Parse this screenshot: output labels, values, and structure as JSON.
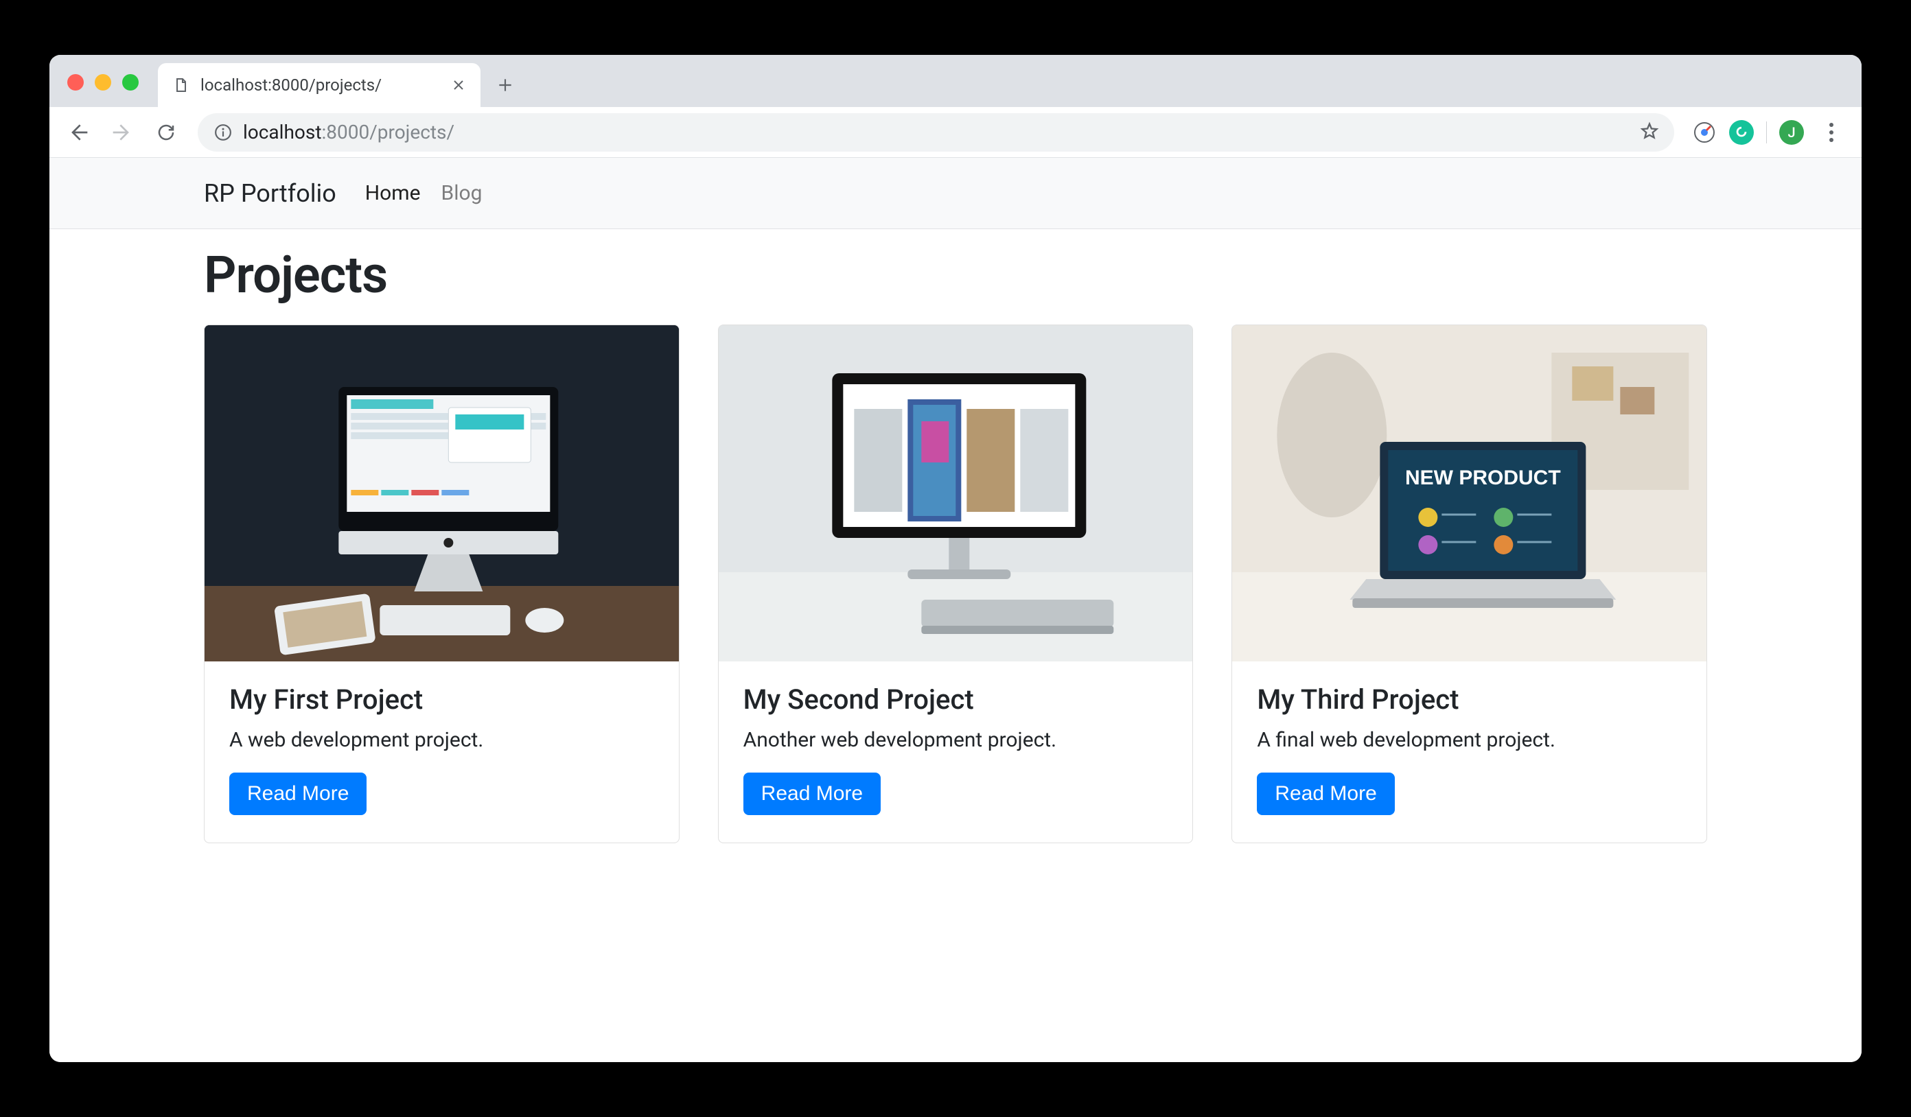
{
  "browser": {
    "tab": {
      "title": "localhost:8000/projects/"
    },
    "url": {
      "host": "localhost",
      "port": ":8000",
      "path": "/projects/"
    },
    "avatar_initial": "J"
  },
  "navbar": {
    "brand": "RP Portfolio",
    "links": [
      {
        "label": "Home",
        "active": true
      },
      {
        "label": "Blog",
        "active": false
      }
    ]
  },
  "page": {
    "heading": "Projects"
  },
  "projects": [
    {
      "title": "My First Project",
      "description": "A web development project.",
      "button": "Read More"
    },
    {
      "title": "My Second Project",
      "description": "Another web development project.",
      "button": "Read More"
    },
    {
      "title": "My Third Project",
      "description": "A final web development project.",
      "button": "Read More"
    }
  ]
}
